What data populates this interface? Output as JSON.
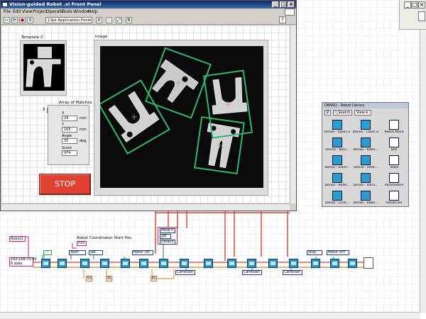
{
  "front_panel": {
    "title": "Vision-guided Robot .vi Front Panel",
    "menu": [
      "File",
      "Edit",
      "View",
      "Project",
      "Operate",
      "Tools",
      "Window",
      "Help"
    ],
    "font_select": "13pt Application Font",
    "template_label": "Template 2",
    "image_label": "Image",
    "matches": {
      "label": "Array of Matches",
      "index": "0",
      "x_label": "X",
      "x_value": "24",
      "y_label": "Y",
      "y_value": "165",
      "unit_mm": "mm",
      "angle_label": "Angle",
      "angle_value": "35",
      "unit_deg": "deg",
      "score_label": "Score",
      "score_value": "974"
    },
    "stop_label": "STOP"
  },
  "library": {
    "title": "DENSO - Robot Library",
    "search_label": "Search",
    "view_label": "View",
    "items": [
      {
        "label": "Denso - Open.vi",
        "icon": "vi-icon"
      },
      {
        "label": "Denso - Close.vi",
        "icon": "vi-icon"
      },
      {
        "label": "Robot Move",
        "icon": "folder-icon"
      },
      {
        "label": "Denso - Serv...",
        "icon": "vi-icon"
      },
      {
        "label": "Denso - RobS...",
        "icon": "vi-icon"
      },
      {
        "label": "DIO",
        "icon": "folder-icon"
      },
      {
        "label": "Denso - Enter...",
        "icon": "vi-icon"
      },
      {
        "label": "Denso - Inter...",
        "icon": "vi-icon"
      },
      {
        "label": "Tasks",
        "icon": "folder-icon"
      },
      {
        "label": "Denso - Read...",
        "icon": "vi-icon"
      },
      {
        "label": "Denso - Varia...",
        "icon": "vi-icon"
      },
      {
        "label": "Parameters",
        "icon": "folder-icon"
      },
      {
        "label": "Denso - Error...",
        "icon": "vi-icon"
      },
      {
        "label": "Denso - Robo...",
        "icon": "vi-icon"
      },
      {
        "label": "Advanced",
        "icon": "folder-icon"
      }
    ]
  },
  "diagram": {
    "robot_label": "Robot1",
    "ip_address": "192.168.70.90",
    "axes": "6 axes",
    "bool_const": "TF",
    "coord_label": "Robot Coordinates Start Pos.",
    "pos_ring": "P10",
    "start": "Start",
    "set": "Set",
    "motor_on": "Motor ON",
    "move_p": "Move P",
    "at": "@E",
    "default": "Default",
    "stop": "Stop",
    "motor_off": "Motor OFF",
    "cartesian": "Cartesian",
    "const_50": "50",
    "const_30": "30",
    "const_80": "80"
  },
  "colors": {
    "title_bar": "#0a246a",
    "stop_red": "#e14035",
    "match_box": "#2fb872",
    "wire_red": "#d9432f",
    "wire_pink": "#cc2277",
    "vi_node": "#2b95c4"
  }
}
